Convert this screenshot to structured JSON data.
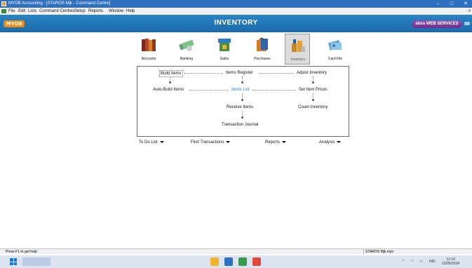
{
  "window": {
    "title": "MYOB Accounting - [STAROS Mjk - Command Centre]",
    "minimize_glyph": "–",
    "maximize_glyph": "□",
    "close_glyph": "✕"
  },
  "menu": {
    "items": [
      "File",
      "Edit",
      "Lists",
      "Command Centres",
      "Setup",
      "Reports",
      "Window",
      "Help"
    ],
    "restore_glyph": "- ♯"
  },
  "header": {
    "logo": "MYOB",
    "title": "INVENTORY",
    "web_services": "abss WEB SERVICES"
  },
  "modules": [
    {
      "label": "Accounts",
      "icon": "accounts-books-icon"
    },
    {
      "label": "Banking",
      "icon": "banking-icon"
    },
    {
      "label": "Sales",
      "icon": "sales-icon"
    },
    {
      "label": "Purchases",
      "icon": "purchases-bag-icon"
    },
    {
      "label": "Inventory",
      "icon": "inventory-icon"
    },
    {
      "label": "Card File",
      "icon": "card-file-icon"
    }
  ],
  "flow": {
    "build_items": "Build Items",
    "items_register": "Items Register",
    "adjust_inventory": "Adjust Inventory",
    "auto_build_items": "Auto-Build Items",
    "items_list": "Items List",
    "set_item_prices": "Set Item Prices",
    "receive_items": "Receive Items",
    "count_inventory": "Count Inventory",
    "transaction_journal": "Transaction Journal"
  },
  "actions": {
    "todo": "To Do List",
    "find": "Find Transactions",
    "reports": "Reports",
    "analysis": "Analysis"
  },
  "status": {
    "help": "Press F1 to get help",
    "file": "STAROS Mjk.myo"
  },
  "taskbar": {
    "tray_lang": "IND",
    "time": "12:14",
    "date": "22/05/2024"
  },
  "colors": {
    "header": "#1f74b8",
    "accent_orange": "#f08a12",
    "highlight_link": "#1f7bd6",
    "web_services": "#7a3a9c"
  }
}
